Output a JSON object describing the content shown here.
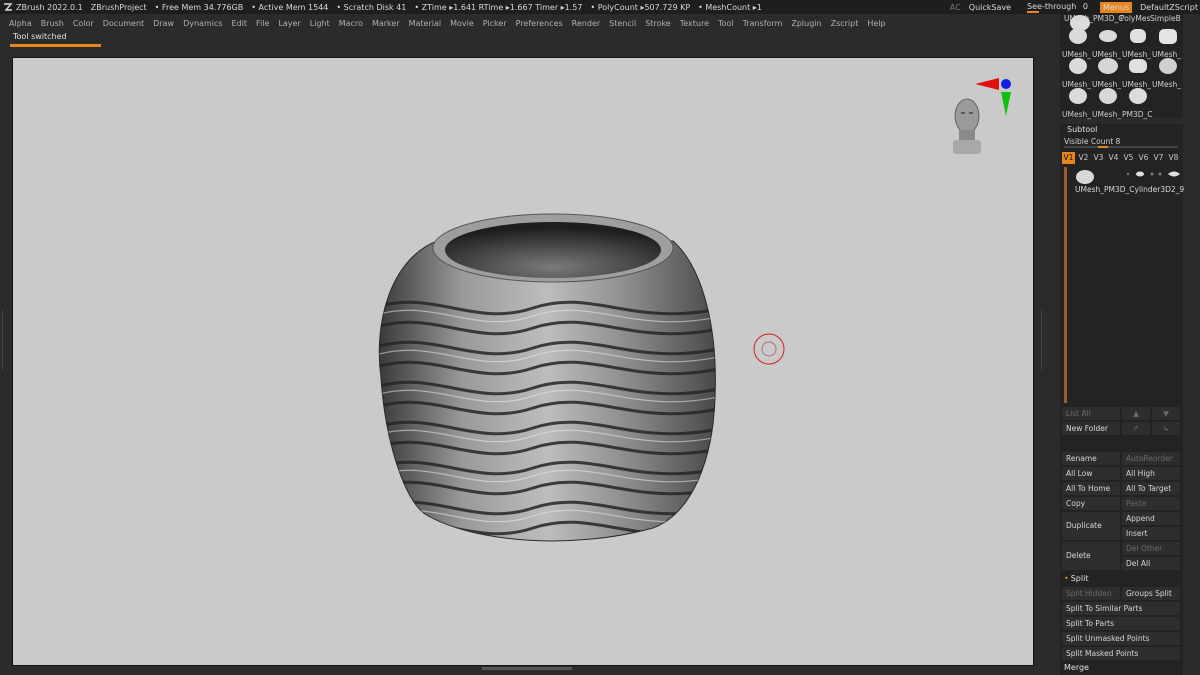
{
  "titlebar": {
    "app": "ZBrush 2022.0.1",
    "project": "ZBrushProject",
    "free_mem": "• Free Mem 34.776GB",
    "active_mem": "• Active Mem 1544",
    "scratch": "• Scratch Disk 41",
    "ztime": "• ZTime ▸1.641 RTime ▸1.667 Timer ▸1.57",
    "polycount": "• PolyCount ▸507.729 KP",
    "meshcount": "• MeshCount ▸1",
    "ac": "AC",
    "quicksave": "QuickSave",
    "seethrough": "See-through",
    "seethrough_value": "0",
    "menus": "Menus",
    "script": "DefaultZScript"
  },
  "menubar": {
    "items": [
      "Alpha",
      "Brush",
      "Color",
      "Document",
      "Draw",
      "Dynamics",
      "Edit",
      "File",
      "Layer",
      "Light",
      "Macro",
      "Marker",
      "Material",
      "Movie",
      "Picker",
      "Preferences",
      "Render",
      "Stencil",
      "Stroke",
      "Texture",
      "Tool",
      "Transform",
      "Zplugin",
      "Zscript",
      "Help"
    ]
  },
  "notice": "Tool switched",
  "thumbnails": {
    "row1": [
      "UMesh_PM3D_C",
      "PolyMes",
      "SimpleB"
    ],
    "row2": [
      "UMesh_",
      "UMesh_",
      "UMesh_",
      "UMesh_"
    ],
    "row3": [
      "UMesh_",
      "UMesh_",
      "UMesh_",
      "UMesh_"
    ],
    "row4": [
      "UMesh_",
      "UMesh_",
      "PM3D_C"
    ]
  },
  "subtool": {
    "title": "Subtool",
    "visible_count_label": "Visible Count 8",
    "visible_fraction": 0.3,
    "tabs": [
      "V1",
      "V2",
      "V3",
      "V4",
      "V5",
      "V6",
      "V7",
      "V8"
    ],
    "item_name": "UMesh_PM3D_Cylinder3D2_9",
    "list_all": "List All",
    "new_folder": "New Folder",
    "rename": "Rename",
    "auto_reorder": "AutoReorder",
    "all_low": "All Low",
    "all_high": "All High",
    "all_to_home": "All To Home",
    "all_to_target": "All To Target",
    "copy": "Copy",
    "paste": "Paste",
    "duplicate": "Duplicate",
    "append": "Append",
    "insert": "Insert",
    "delete": "Delete",
    "del_other": "Del Other",
    "del_all": "Del All",
    "split_title": "Split",
    "split_hidden": "Split Hidden",
    "groups_split": "Groups Split",
    "split_similar": "Split To Similar Parts",
    "split_parts": "Split To Parts",
    "split_unmasked": "Split Unmasked Points",
    "split_masked": "Split Masked Points",
    "merge_title": "Merge"
  },
  "colors": {
    "accent": "#e8851f",
    "viewport_bg": "#cacaca",
    "panel_bg": "#232323",
    "brush_cursor": "#d02020"
  }
}
